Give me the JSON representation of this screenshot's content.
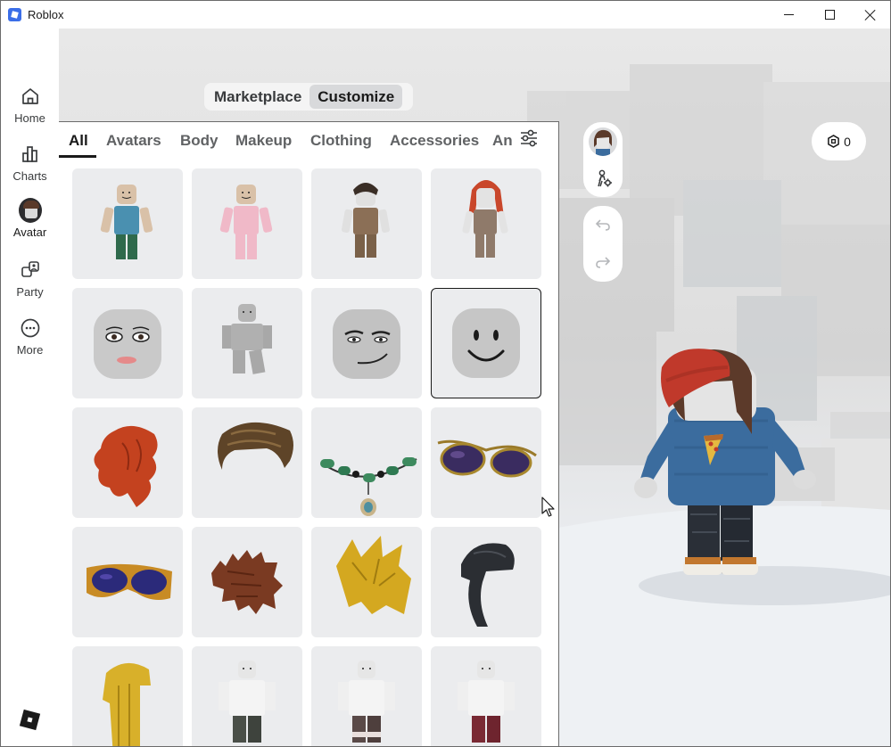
{
  "window": {
    "title": "Roblox"
  },
  "sidebar": {
    "items": [
      {
        "label": "Home",
        "icon": "home-icon"
      },
      {
        "label": "Charts",
        "icon": "charts-icon"
      },
      {
        "label": "Avatar",
        "icon": "avatar-icon",
        "active": true
      },
      {
        "label": "Party",
        "icon": "party-icon"
      },
      {
        "label": "More",
        "icon": "more-icon"
      }
    ]
  },
  "mode_switch": {
    "marketplace": "Marketplace",
    "customize": "Customize",
    "selected": "Customize"
  },
  "tabs": [
    {
      "label": "All",
      "active": true
    },
    {
      "label": "Avatars"
    },
    {
      "label": "Body"
    },
    {
      "label": "Makeup"
    },
    {
      "label": "Clothing"
    },
    {
      "label": "Accessories"
    },
    {
      "label": "An"
    }
  ],
  "items": [
    {
      "kind": "avatar-blue"
    },
    {
      "kind": "avatar-pink"
    },
    {
      "kind": "avatar-brown-hair"
    },
    {
      "kind": "avatar-red-hair"
    },
    {
      "kind": "face-woman"
    },
    {
      "kind": "body-gray"
    },
    {
      "kind": "face-smirk"
    },
    {
      "kind": "face-smile",
      "selected": true
    },
    {
      "kind": "hair-red"
    },
    {
      "kind": "hair-brown"
    },
    {
      "kind": "necklace-jade"
    },
    {
      "kind": "sunglasses-aviator"
    },
    {
      "kind": "sunglasses-orange"
    },
    {
      "kind": "hair-spiky-brown"
    },
    {
      "kind": "hair-gold-spiky"
    },
    {
      "kind": "hair-black-tail"
    },
    {
      "kind": "hair-gold-long"
    },
    {
      "kind": "outfit-white-1"
    },
    {
      "kind": "outfit-white-2"
    },
    {
      "kind": "outfit-white-3"
    }
  ],
  "robux": {
    "amount": "0"
  },
  "colors": {
    "accent": "#1a1a1a",
    "tile": "#ebecee",
    "brand": "#3b6ee8"
  }
}
